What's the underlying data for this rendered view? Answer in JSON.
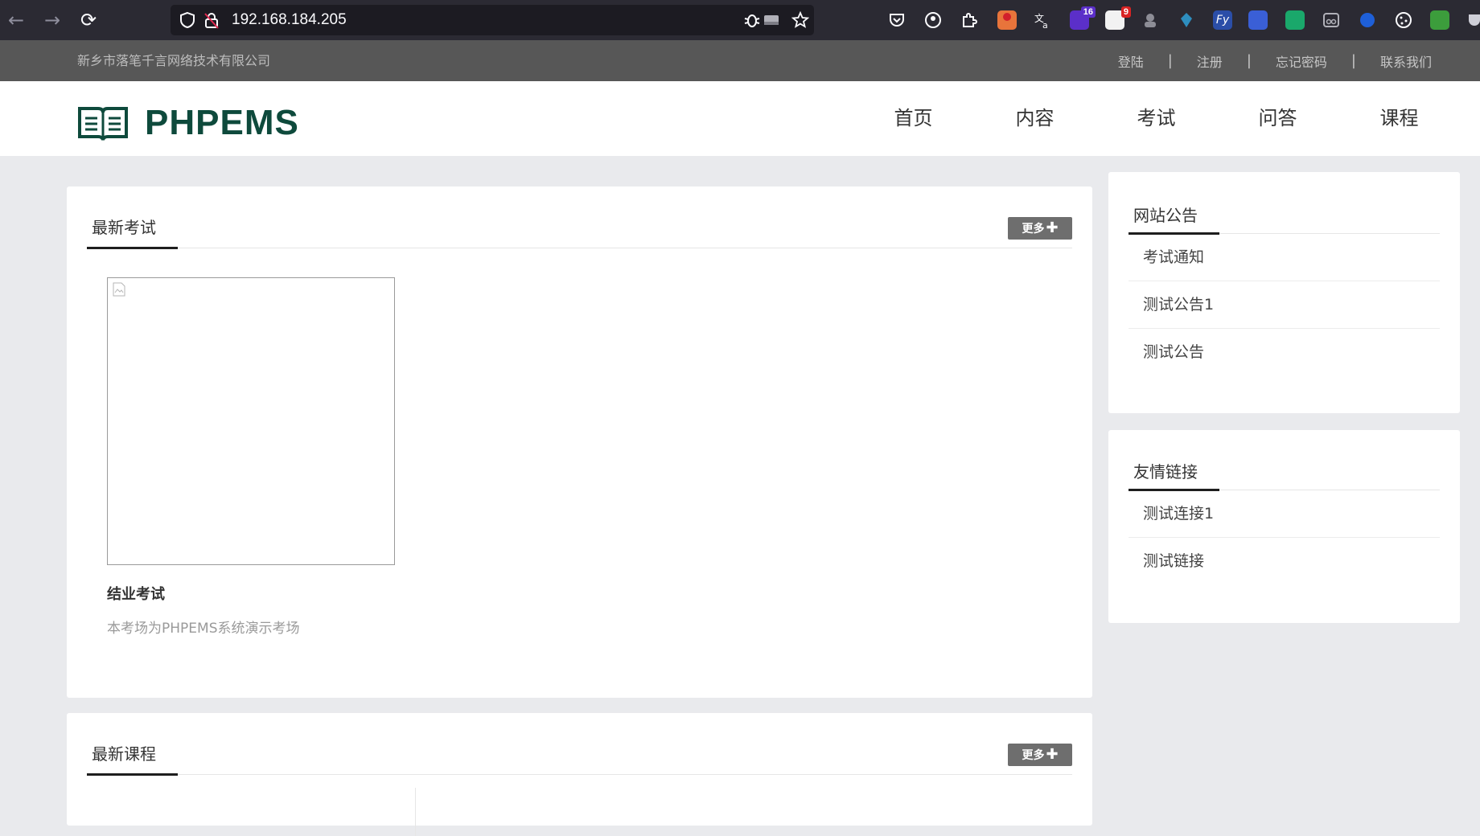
{
  "browser": {
    "back_icon": "←",
    "forward_icon": "→",
    "reload_icon": "⟳",
    "url": "192.168.184.205",
    "ext_badges": {
      "ext1": "16",
      "ext2": "9"
    }
  },
  "topbar": {
    "company": "新乡市落笔千言网络技术有限公司",
    "links": [
      "登陆",
      "注册",
      "忘记密码",
      "联系我们"
    ]
  },
  "header": {
    "logo_text": "PHPEMS",
    "nav": [
      "首页",
      "内容",
      "考试",
      "问答",
      "课程"
    ]
  },
  "exams": {
    "title": "最新考试",
    "more_label": "更多",
    "more_plus": "✚",
    "items": [
      {
        "title": "结业考试",
        "desc": "本考场为PHPEMS系统演示考场"
      }
    ]
  },
  "courses": {
    "title": "最新课程",
    "more_label": "更多",
    "more_plus": "✚"
  },
  "notices": {
    "title": "网站公告",
    "items": [
      "考试通知",
      "测试公告1",
      "测试公告"
    ]
  },
  "links": {
    "title": "友情链接",
    "items": [
      "测试连接1",
      "测试链接"
    ]
  },
  "colors": {
    "brand": "#0e4a3c",
    "topbar": "#575757",
    "browser": "#2b2a33"
  }
}
